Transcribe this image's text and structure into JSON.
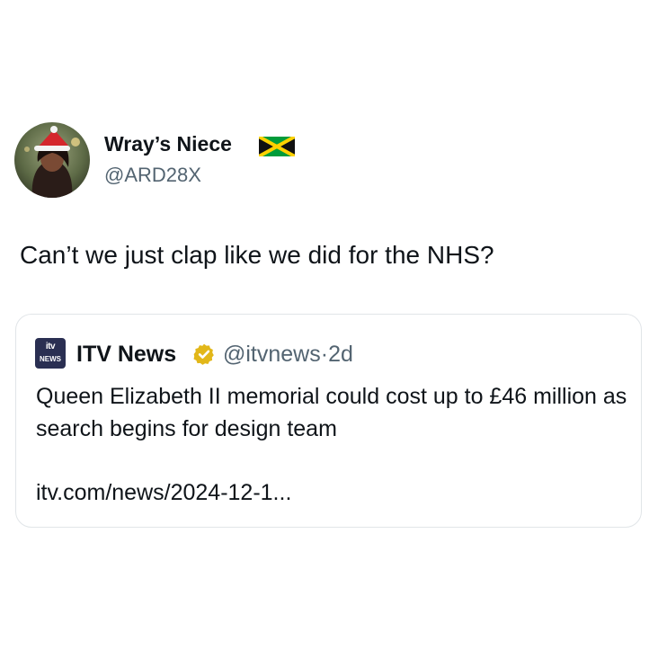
{
  "tweet": {
    "author": {
      "display_name": "Wray’s Niece",
      "handle": "@ARD28X",
      "flag_icon": "jamaica-flag-icon",
      "avatar_icon": "profile-photo-santa-hat"
    },
    "text": "Can’t we just clap like we did for the NHS?"
  },
  "quote": {
    "logo": {
      "top": "itv",
      "bottom": "NEWS"
    },
    "display_name": "ITV News",
    "verified_icon": "gold-verified-badge-icon",
    "handle": "@itvnews",
    "separator": "·",
    "age": "2d",
    "text": "Queen Elizabeth II memorial could cost up to £46 million as search begins for design team",
    "link": "itv.com/news/2024-12-1..."
  },
  "colors": {
    "text_primary": "#0f1419",
    "text_secondary": "#536471",
    "card_border": "#e1e5e8",
    "verified_gold": "#e2b719",
    "itv_logo_bg": "#2a2f52"
  }
}
